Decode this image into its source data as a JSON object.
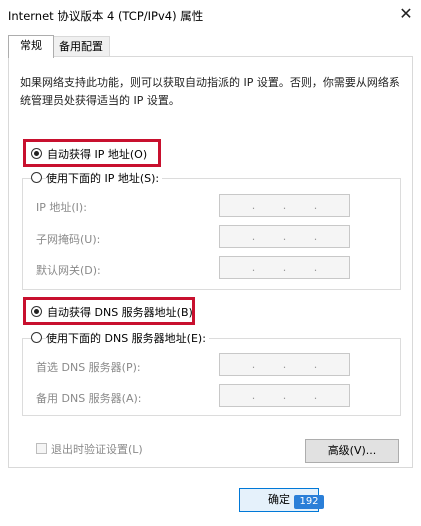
{
  "window": {
    "title": "Internet 协议版本 4 (TCP/IPv4) 属性",
    "close_glyph": "✕"
  },
  "tabs": [
    {
      "label": "常规",
      "active": true
    },
    {
      "label": "备用配置",
      "active": false
    }
  ],
  "description": "如果网络支持此功能，则可以获取自动指派的 IP 设置。否则，你需要从网络系统管理员处获得适当的 IP 设置。",
  "ip_section": {
    "auto_label": "自动获得 IP 地址(O)",
    "auto_selected": true,
    "manual_label": "使用下面的 IP 地址(S):",
    "manual_selected": false,
    "fields": [
      {
        "label": "IP 地址(I):",
        "value": ". . ."
      },
      {
        "label": "子网掩码(U):",
        "value": ". . ."
      },
      {
        "label": "默认网关(D):",
        "value": ". . ."
      }
    ]
  },
  "dns_section": {
    "auto_label": "自动获得 DNS 服务器地址(B)",
    "auto_selected": true,
    "manual_label": "使用下面的 DNS 服务器地址(E):",
    "manual_selected": false,
    "fields": [
      {
        "label": "首选 DNS 服务器(P):",
        "value": ". . ."
      },
      {
        "label": "备用 DNS 服务器(A):",
        "value": ". . ."
      }
    ]
  },
  "validate_checkbox": {
    "label": "退出时验证设置(L)",
    "checked": false
  },
  "advanced_button": "高级(V)...",
  "ok_button": "确定",
  "watermark": "192",
  "highlight_color": "#c8102e"
}
